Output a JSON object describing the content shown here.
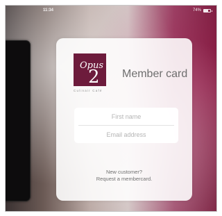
{
  "status_bar": {
    "time": "11:34",
    "battery_text": "74%"
  },
  "card": {
    "title": "Member card",
    "logo": {
      "script_text": "Opus",
      "number": "2",
      "tagline": "Culinair Café"
    },
    "form": {
      "first_name_placeholder": "First name",
      "email_placeholder": "Email address"
    },
    "signup": {
      "line1": "New customer?",
      "line2": "Request a membercard."
    }
  },
  "colors": {
    "brand": "#6d1b3c",
    "title_text": "#6e6e6e",
    "placeholder": "#b4b4b4"
  },
  "icons": [
    "battery-icon"
  ]
}
